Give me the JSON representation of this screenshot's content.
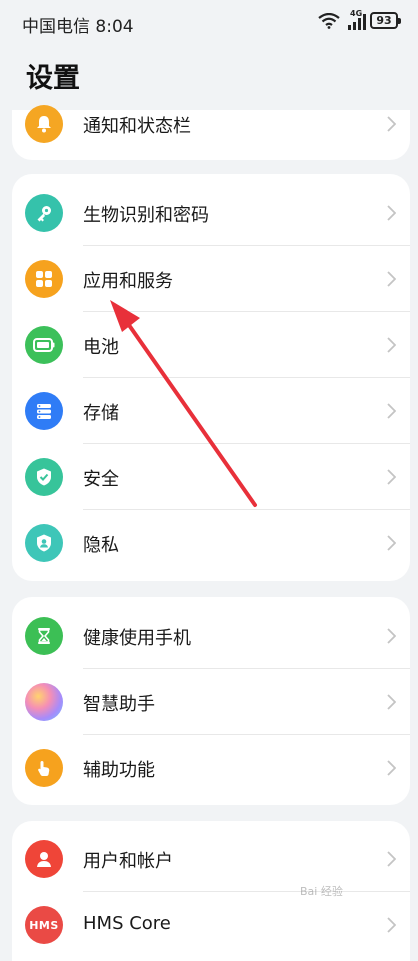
{
  "status_bar": {
    "carrier_time": "中国电信 8:04",
    "network_label": "4G",
    "battery_level": "93"
  },
  "page": {
    "title": "设置"
  },
  "groups": [
    {
      "items": [
        {
          "label": "通知和状态栏",
          "icon": "bell-icon",
          "color": "#f5a623"
        }
      ]
    },
    {
      "items": [
        {
          "label": "生物识别和密码",
          "icon": "key-icon",
          "color": "#35c2ab"
        },
        {
          "label": "应用和服务",
          "icon": "apps-grid-icon",
          "color": "#f6a21e"
        },
        {
          "label": "电池",
          "icon": "battery-icon",
          "color": "#3cc05a"
        },
        {
          "label": "存储",
          "icon": "storage-icon",
          "color": "#2f7cf6"
        },
        {
          "label": "安全",
          "icon": "shield-check-icon",
          "color": "#37c49a"
        },
        {
          "label": "隐私",
          "icon": "privacy-shield-icon",
          "color": "#3ec6b8"
        }
      ]
    },
    {
      "items": [
        {
          "label": "健康使用手机",
          "icon": "hourglass-icon",
          "color": "#3cbf55"
        },
        {
          "label": "智慧助手",
          "icon": "assistant-orb-icon",
          "color": "#a78bfa"
        },
        {
          "label": "辅助功能",
          "icon": "hand-tap-icon",
          "color": "#f6a21e"
        }
      ]
    },
    {
      "items": [
        {
          "label": "用户和帐户",
          "icon": "user-icon",
          "color": "#ef4538"
        },
        {
          "label": "HMS Core",
          "icon": "hms-icon",
          "color": "#ea4a45",
          "icon_text": "HMS"
        }
      ]
    }
  ],
  "watermark": {
    "text": "Bai 经验"
  }
}
